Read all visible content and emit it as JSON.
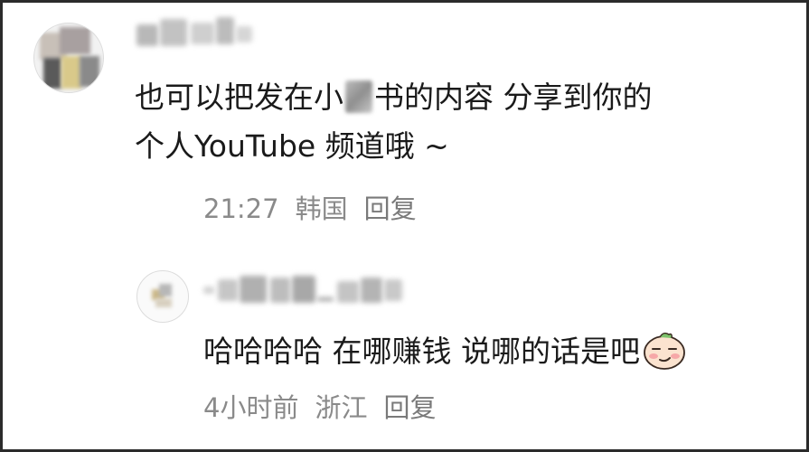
{
  "comments": [
    {
      "text_line1_a": "也可以把发在小",
      "text_line1_b": "书的内容 分享到你的",
      "text_line2": "个人YouTube 频道哦 ~",
      "time": "21:27",
      "location": "韩国",
      "reply_label": "回复"
    },
    {
      "text": "哈哈哈哈 在哪赚钱 说哪的话是吧",
      "emoji_icon": "smirk-face-emoji-icon",
      "time": "4小时前",
      "location": "浙江",
      "reply_label": "回复"
    }
  ],
  "colors": {
    "text": "#1a1a1a",
    "meta": "#8a8a8a",
    "border": "#2b2b2b"
  }
}
